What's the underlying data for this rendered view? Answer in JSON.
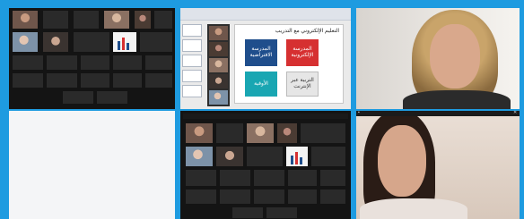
{
  "tiles": {
    "gallery_top": {
      "labels": [
        "",
        "",
        "",
        "",
        "",
        "",
        "",
        "",
        "",
        "",
        "",
        "",
        "",
        "",
        "",
        "",
        "",
        "",
        "",
        "",
        ""
      ]
    },
    "slide": {
      "title": "التعليم الإلكتروني مع التدريب",
      "boxes": [
        "المدرسة الافتراضية",
        "المدرسة الإلكترونية",
        "الأوقية",
        "التربية عبر الإنترنت"
      ]
    },
    "gallery_bottom": {
      "labels": [
        "",
        "",
        "",
        "",
        "",
        "",
        "",
        "",
        "",
        "",
        "",
        "",
        "",
        "",
        "",
        "",
        "",
        "",
        ""
      ]
    }
  },
  "colors": {
    "frame": "#1e9be0",
    "gallery_bg": "#141414",
    "slide_red": "#d63031",
    "slide_blue": "#1f4e8c",
    "slide_teal": "#19a6b2"
  }
}
